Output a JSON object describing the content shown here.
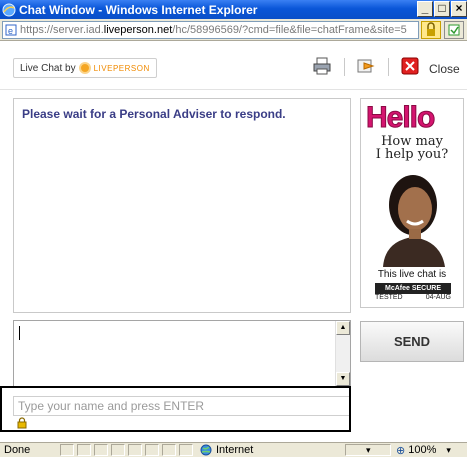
{
  "window": {
    "title": "Chat Window - Windows Internet Explorer",
    "minimize": "_",
    "maximize": "□",
    "close": "×"
  },
  "address": {
    "url_prefix": "https://server.iad.",
    "url_domain": "liveperson.net",
    "url_rest": "/hc/58996569/?cmd=file&file=chatFrame&site=5"
  },
  "toolbar": {
    "brand_prefix": "Live Chat by",
    "brand_name": "LIVEPERSON",
    "close_label": "Close"
  },
  "chat": {
    "wait_message": "Please wait for a Personal Adviser to respond."
  },
  "ad": {
    "hello": "Hello",
    "line1": "How may",
    "line2": "I help you?",
    "secure_text": "This live chat is",
    "mcafee": "McAfee SECURE",
    "tested": "TESTED",
    "tested_date": "04-AUG"
  },
  "input": {
    "send_label": "SEND",
    "name_placeholder": "Type your name and press ENTER"
  },
  "statusbar": {
    "status": "Done",
    "zone": "Internet",
    "zoom": "100%"
  },
  "colors": {
    "title_bar": "#0a56d8",
    "message_text": "#3a3d86",
    "hello_pink": "#d4146f",
    "brand_orange": "#f08a00"
  }
}
